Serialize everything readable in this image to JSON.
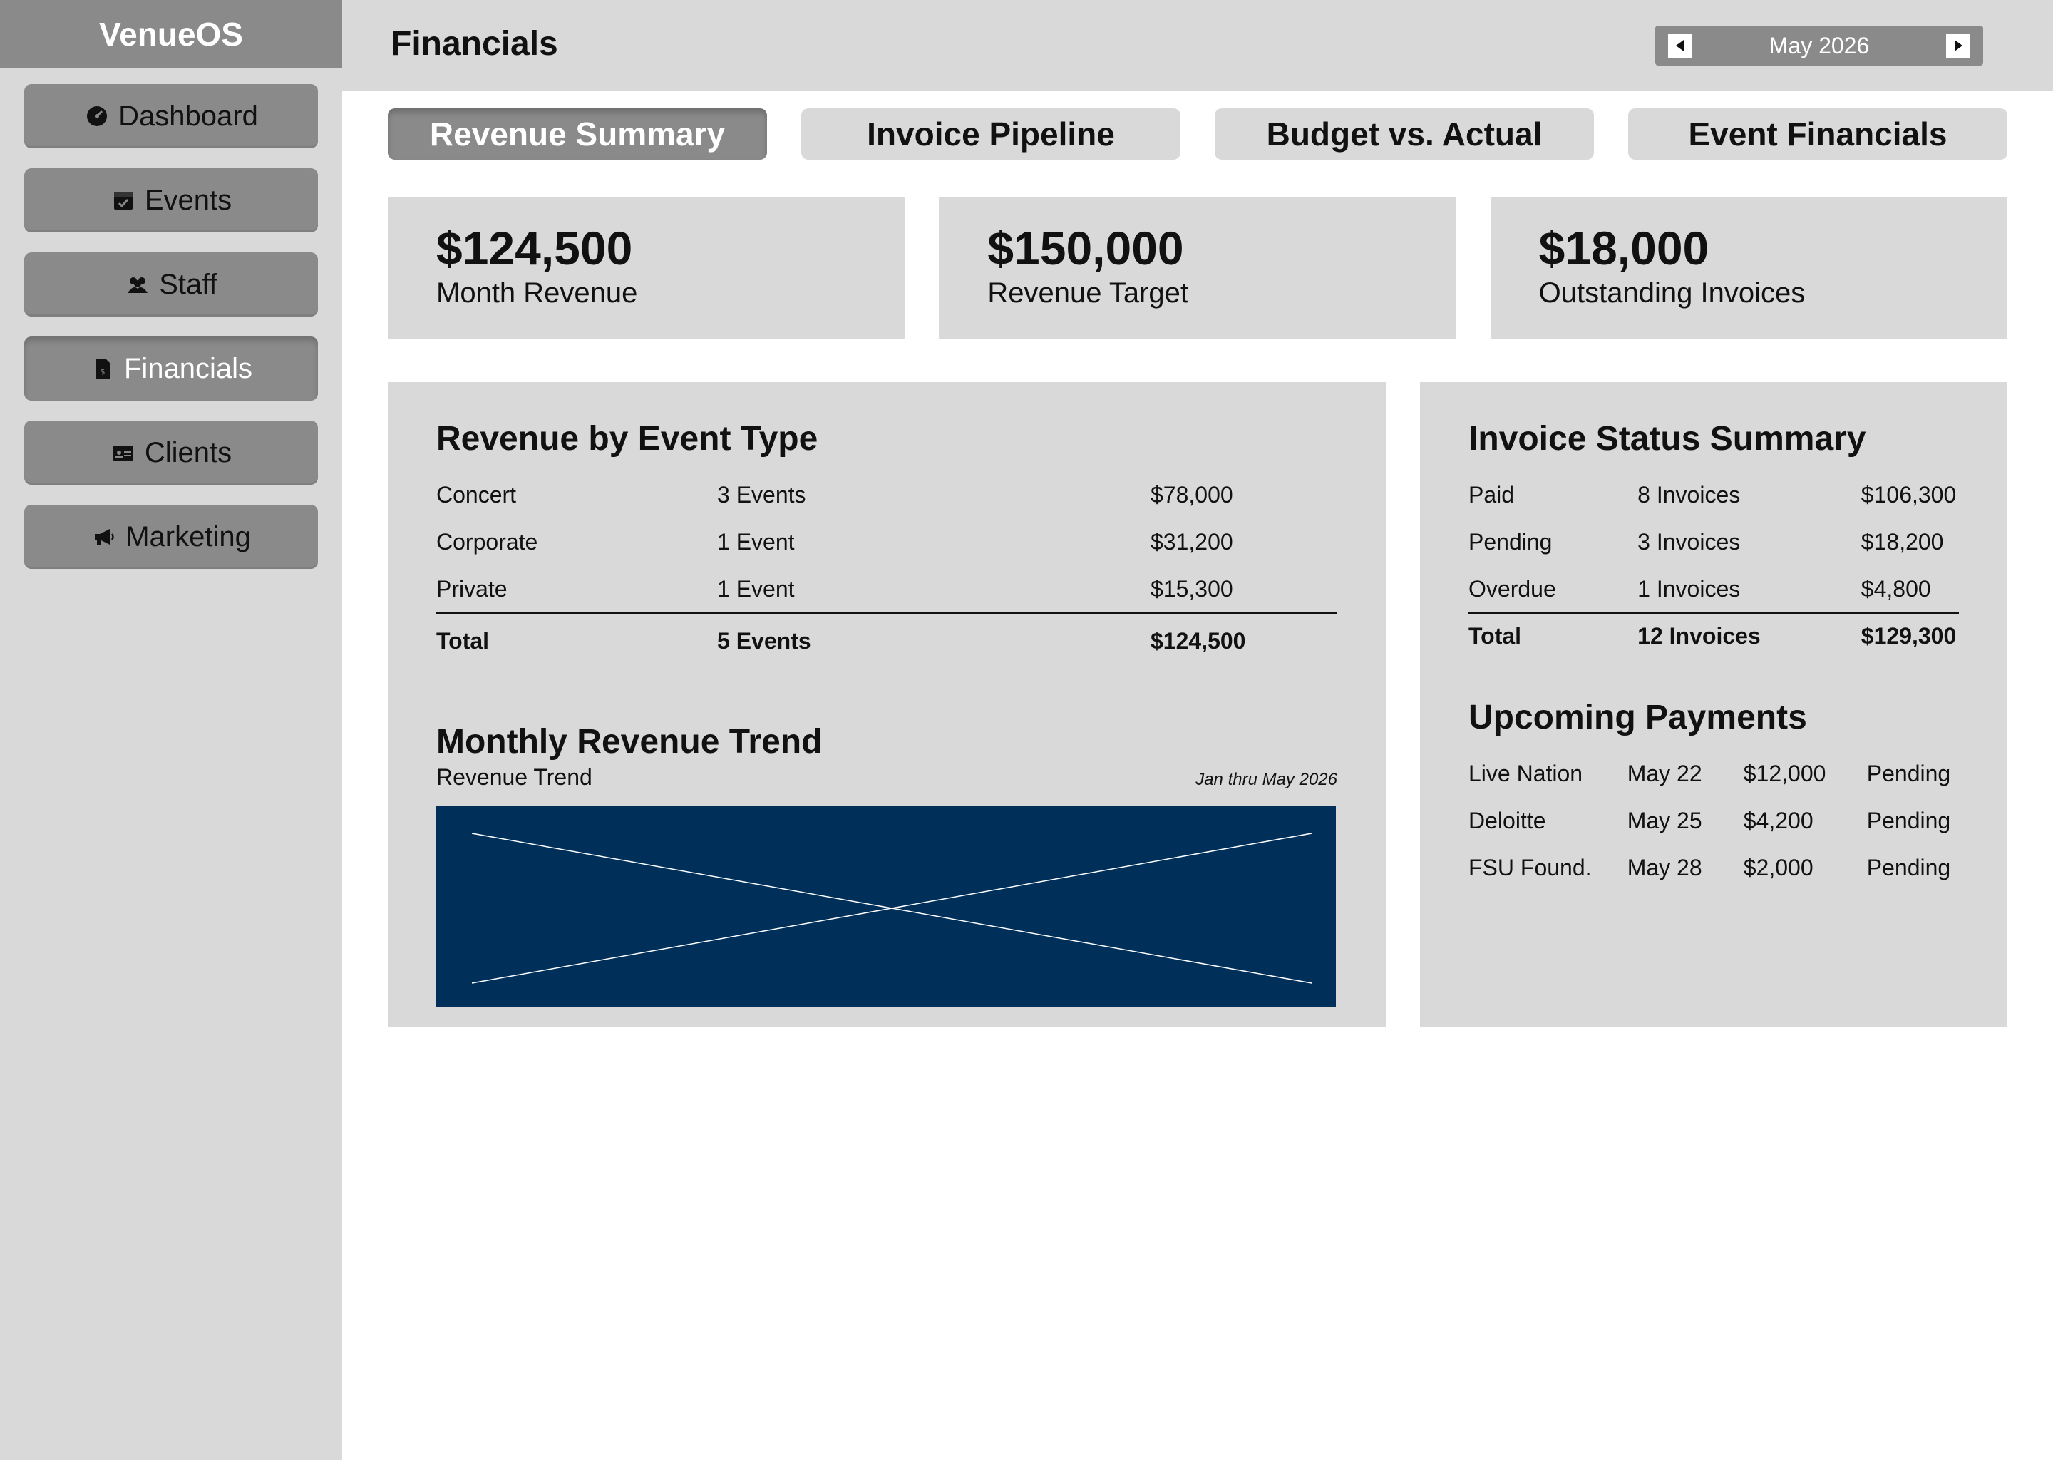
{
  "app": {
    "name": "VenueOS"
  },
  "sidebar": {
    "items": [
      {
        "label": "Dashboard",
        "icon": "dashboard-icon"
      },
      {
        "label": "Events",
        "icon": "calendar-icon"
      },
      {
        "label": "Staff",
        "icon": "people-icon"
      },
      {
        "label": "Financials",
        "icon": "invoice-icon",
        "active": true
      },
      {
        "label": "Clients",
        "icon": "id-card-icon"
      },
      {
        "label": "Marketing",
        "icon": "megaphone-icon"
      }
    ]
  },
  "header": {
    "title": "Financials",
    "month": "May 2026"
  },
  "tabs": [
    {
      "label": "Revenue Summary",
      "active": true
    },
    {
      "label": "Invoice Pipeline"
    },
    {
      "label": "Budget vs. Actual"
    },
    {
      "label": "Event Financials"
    }
  ],
  "kpis": [
    {
      "value": "$124,500",
      "label": "Month Revenue"
    },
    {
      "value": "$150,000",
      "label": "Revenue Target"
    },
    {
      "value": "$18,000",
      "label": "Outstanding Invoices"
    }
  ],
  "revenue_by_type": {
    "title": "Revenue by Event Type",
    "rows": [
      {
        "type": "Concert",
        "events": "3 Events",
        "amount": "$78,000"
      },
      {
        "type": "Corporate",
        "events": "1 Event",
        "amount": "$31,200"
      },
      {
        "type": "Private",
        "events": "1 Event",
        "amount": "$15,300"
      }
    ],
    "total": {
      "label": "Total",
      "events": "5 Events",
      "amount": "$124,500"
    }
  },
  "trend": {
    "title": "Monthly Revenue Trend",
    "subtitle": "Revenue Trend",
    "range": "Jan thru May 2026",
    "placeholder_color": "#003059"
  },
  "invoice_status": {
    "title": "Invoice Status Summary",
    "rows": [
      {
        "status": "Paid",
        "count": "8 Invoices",
        "amount": "$106,300"
      },
      {
        "status": "Pending",
        "count": "3 Invoices",
        "amount": "$18,200"
      },
      {
        "status": "Overdue",
        "count": "1 Invoices",
        "amount": "$4,800"
      }
    ],
    "total": {
      "label": "Total",
      "count": "12 Invoices",
      "amount": "$129,300"
    }
  },
  "upcoming_payments": {
    "title": "Upcoming Payments",
    "rows": [
      {
        "client": "Live Nation",
        "date": "May 22",
        "amount": "$12,000",
        "status": "Pending"
      },
      {
        "client": "Deloitte",
        "date": "May 25",
        "amount": "$4,200",
        "status": "Pending"
      },
      {
        "client": "FSU Found.",
        "date": "May 28",
        "amount": "$2,000",
        "status": "Pending"
      }
    ]
  }
}
